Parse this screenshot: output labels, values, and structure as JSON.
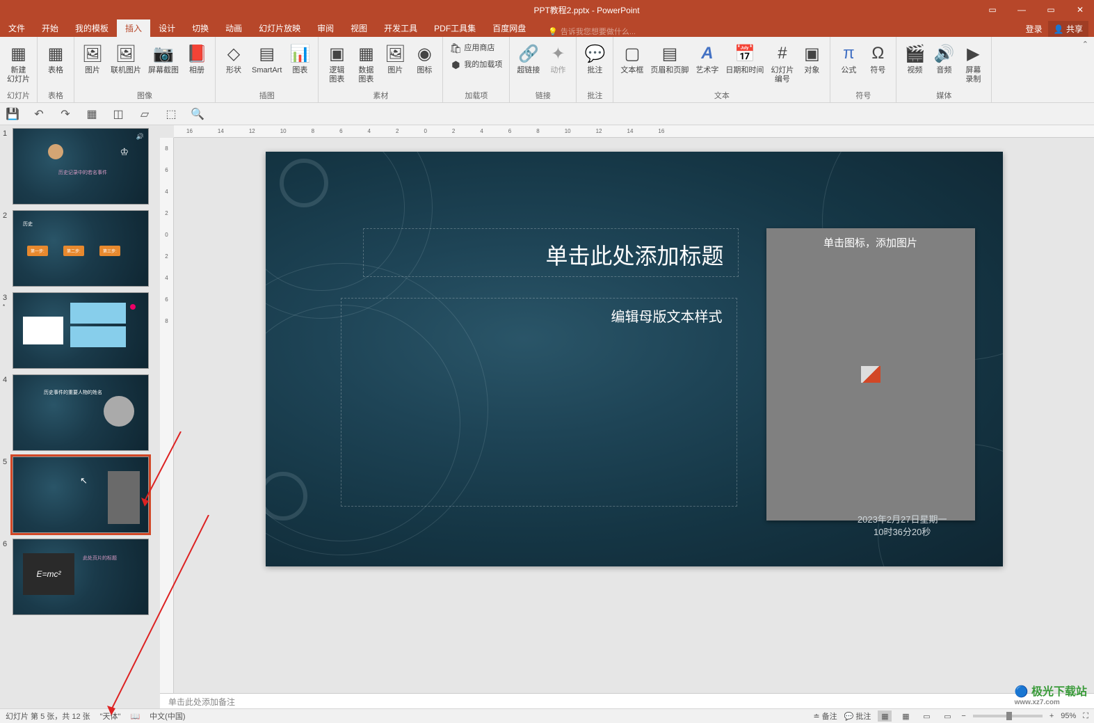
{
  "title": "PPT教程2.pptx - PowerPoint",
  "menu": {
    "file": "文件",
    "tabs": [
      "开始",
      "我的模板",
      "插入",
      "设计",
      "切换",
      "动画",
      "幻灯片放映",
      "审阅",
      "视图",
      "开发工具",
      "PDF工具集",
      "百度网盘"
    ],
    "active": "插入",
    "tellme": "告诉我您想要做什么...",
    "login": "登录",
    "share": "共享"
  },
  "ribbon": {
    "g1": {
      "label": "幻灯片",
      "new_slide": "新建\n幻灯片"
    },
    "g2": {
      "label": "表格",
      "table": "表格"
    },
    "g3": {
      "label": "图像",
      "pic": "图片",
      "online_pic": "联机图片",
      "screenshot": "屏幕截图",
      "album": "相册"
    },
    "g4": {
      "label": "插图",
      "shapes": "形状",
      "smartart": "SmartArt",
      "chart": "图表"
    },
    "g5": {
      "label": "素材",
      "logic_chart": "逻辑\n图表",
      "data_chart": "数据\n图表",
      "pic2": "图片",
      "icon": "图标"
    },
    "g6": {
      "label": "加载项",
      "store": "应用商店",
      "myaddins": "我的加载项"
    },
    "g7": {
      "label": "链接",
      "hyperlink": "超链接",
      "action": "动作"
    },
    "g8": {
      "label": "批注",
      "comment": "批注"
    },
    "g9": {
      "label": "文本",
      "textbox": "文本框",
      "headerfooter": "页眉和页脚",
      "wordart": "艺术字",
      "datetime": "日期和时间",
      "slideno": "幻灯片\n编号",
      "object": "对象"
    },
    "g10": {
      "label": "符号",
      "equation": "公式",
      "symbol": "符号"
    },
    "g11": {
      "label": "媒体",
      "video": "视频",
      "audio": "音频",
      "screen_rec": "屏幕\n录制"
    }
  },
  "slide": {
    "title_ph": "单击此处添加标题",
    "body_ph": "编辑母版文本样式",
    "pic_ph": "单击图标，添加图片",
    "date1": "2023年2月27日星期一",
    "date2": "10时36分20秒"
  },
  "notes": "单击此处添加备注",
  "status": {
    "slide_count": "幻灯片 第 5 张，共 12 张",
    "theme": "\"天体\"",
    "lang": "中文(中国)",
    "notes_btn": "备注",
    "comments_btn": "批注",
    "zoom": "95%"
  },
  "thumbs": {
    "t1_title": "历史记录中的若名事件",
    "t2_title": "历史",
    "box1": "第一步:",
    "box2": "第二步:",
    "box3": "第三步:",
    "t4_title": "历史事件的重要人物的姓名",
    "t6_title": "此处页片的标题",
    "emc": "E=mc²"
  },
  "watermark": {
    "main": "极光下载站",
    "sub": "www.xz7.com"
  }
}
